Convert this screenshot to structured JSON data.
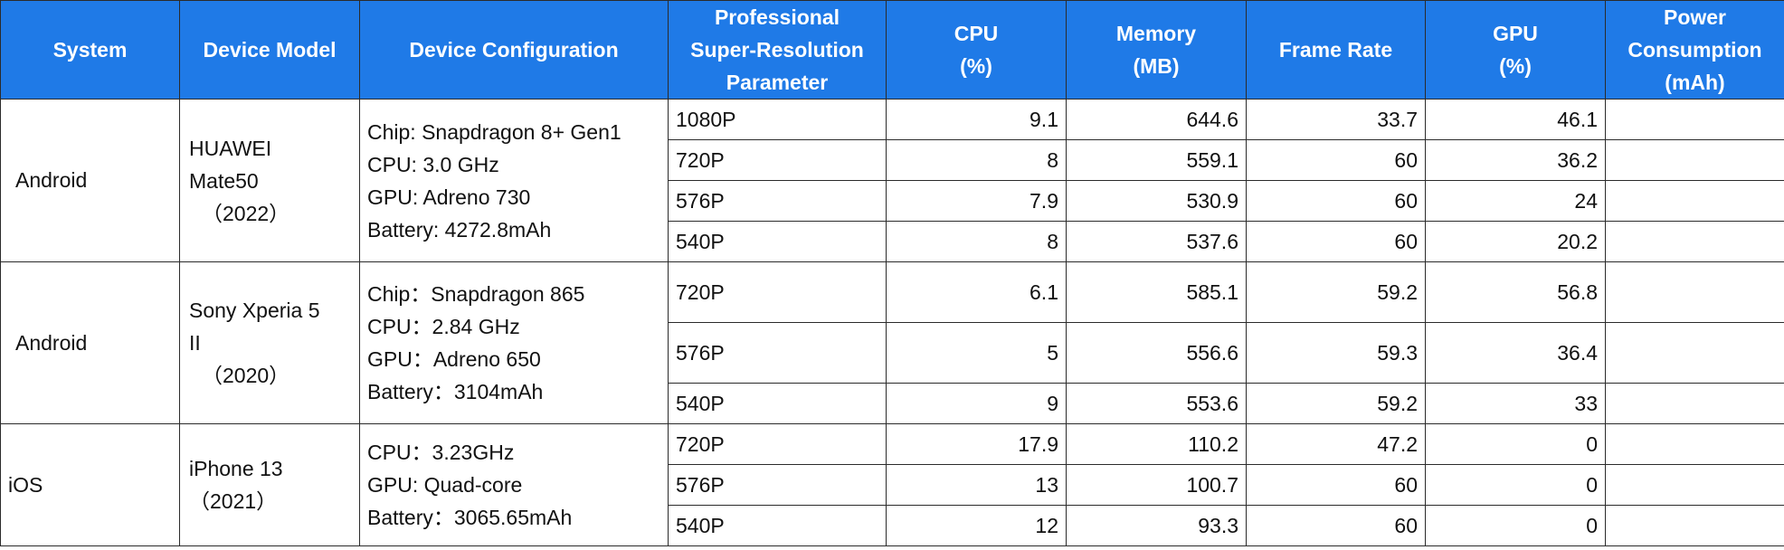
{
  "headers": {
    "system": "System",
    "model": "Device Model",
    "config": "Device Configuration",
    "param": [
      "Professional",
      "Super-Resolution",
      "Parameter"
    ],
    "cpu": [
      "CPU",
      "(%)"
    ],
    "memory": [
      "Memory",
      "(MB)"
    ],
    "frame_rate": "Frame Rate",
    "gpu": [
      "GPU",
      "(%)"
    ],
    "power": [
      "Power",
      "Consumption",
      "(mAh)"
    ]
  },
  "groups": [
    {
      "system": "Android",
      "model": [
        "HUAWEI",
        "Mate50",
        "（2022）"
      ],
      "config": [
        "Chip: Snapdragon 8+ Gen1",
        "CPU: 3.0 GHz",
        "GPU: Adreno 730",
        "Battery: 4272.8mAh"
      ],
      "rows": [
        {
          "res": "1080P",
          "cpu": "9.1",
          "mem": "644.6",
          "fps": "33.7",
          "gpu": "46.1",
          "power": ""
        },
        {
          "res": "720P",
          "cpu": "8",
          "mem": "559.1",
          "fps": "60",
          "gpu": "36.2",
          "power": ""
        },
        {
          "res": "576P",
          "cpu": "7.9",
          "mem": "530.9",
          "fps": "60",
          "gpu": "24",
          "power": ""
        },
        {
          "res": "540P",
          "cpu": "8",
          "mem": "537.6",
          "fps": "60",
          "gpu": "20.2",
          "power": ""
        }
      ]
    },
    {
      "system": "Android",
      "model": [
        "Sony Xperia 5",
        "II",
        "（2020）"
      ],
      "config": [
        "Chip：Snapdragon 865",
        "CPU：2.84 GHz",
        "GPU：Adreno 650",
        "Battery：3104mAh"
      ],
      "rows": [
        {
          "res": "720P",
          "cpu": "6.1",
          "mem": "585.1",
          "fps": "59.2",
          "gpu": "56.8",
          "power": ""
        },
        {
          "res": "576P",
          "cpu": "5",
          "mem": "556.6",
          "fps": "59.3",
          "gpu": "36.4",
          "power": ""
        },
        {
          "res": "540P",
          "cpu": "9",
          "mem": "553.6",
          "fps": "59.2",
          "gpu": "33",
          "power": ""
        }
      ]
    },
    {
      "system": "iOS",
      "model": [
        "iPhone 13",
        "（2021）"
      ],
      "config": [
        "CPU：3.23GHz",
        "GPU: Quad-core",
        "Battery：3065.65mAh"
      ],
      "rows": [
        {
          "res": "720P",
          "cpu": "17.9",
          "mem": "110.2",
          "fps": "47.2",
          "gpu": "0",
          "power": ""
        },
        {
          "res": "576P",
          "cpu": "13",
          "mem": "100.7",
          "fps": "60",
          "gpu": "0",
          "power": ""
        },
        {
          "res": "540P",
          "cpu": "12",
          "mem": "93.3",
          "fps": "60",
          "gpu": "0",
          "power": ""
        }
      ]
    }
  ]
}
